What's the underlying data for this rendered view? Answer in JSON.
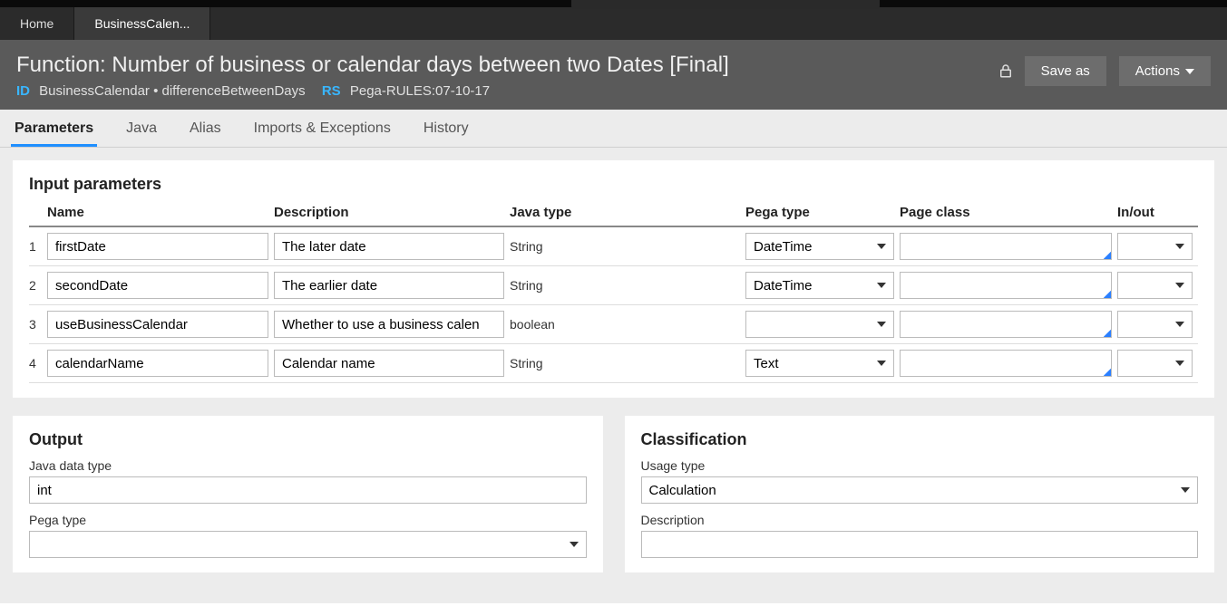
{
  "nav": {
    "home": "Home",
    "doc_tab": "BusinessCalen..."
  },
  "header": {
    "title": "Function: Number of business or calendar days between two Dates [Final]",
    "id_label": "ID",
    "id_value": "BusinessCalendar • differenceBetweenDays",
    "rs_label": "RS",
    "rs_value": "Pega-RULES:07-10-17",
    "save_as": "Save as",
    "actions": "Actions"
  },
  "tabs": {
    "parameters": "Parameters",
    "java": "Java",
    "alias": "Alias",
    "imports": "Imports & Exceptions",
    "history": "History"
  },
  "input_params": {
    "title": "Input parameters",
    "headers": {
      "name": "Name",
      "description": "Description",
      "java_type": "Java type",
      "pega_type": "Pega type",
      "page_class": "Page class",
      "in_out": "In/out"
    },
    "rows": [
      {
        "idx": "1",
        "name": "firstDate",
        "description": "The later date",
        "java_type": "String",
        "pega_type": "DateTime",
        "page_class": "",
        "in_out": ""
      },
      {
        "idx": "2",
        "name": "secondDate",
        "description": "The earlier date",
        "java_type": "String",
        "pega_type": "DateTime",
        "page_class": "",
        "in_out": ""
      },
      {
        "idx": "3",
        "name": "useBusinessCalendar",
        "description": "Whether to use a business calen",
        "java_type": "boolean",
        "pega_type": "",
        "page_class": "",
        "in_out": ""
      },
      {
        "idx": "4",
        "name": "calendarName",
        "description": "Calendar name",
        "java_type": "String",
        "pega_type": "Text",
        "page_class": "",
        "in_out": ""
      }
    ]
  },
  "output": {
    "title": "Output",
    "java_type_label": "Java data type",
    "java_type_value": "int",
    "pega_type_label": "Pega type",
    "pega_type_value": ""
  },
  "classification": {
    "title": "Classification",
    "usage_label": "Usage type",
    "usage_value": "Calculation",
    "description_label": "Description",
    "description_value": ""
  }
}
